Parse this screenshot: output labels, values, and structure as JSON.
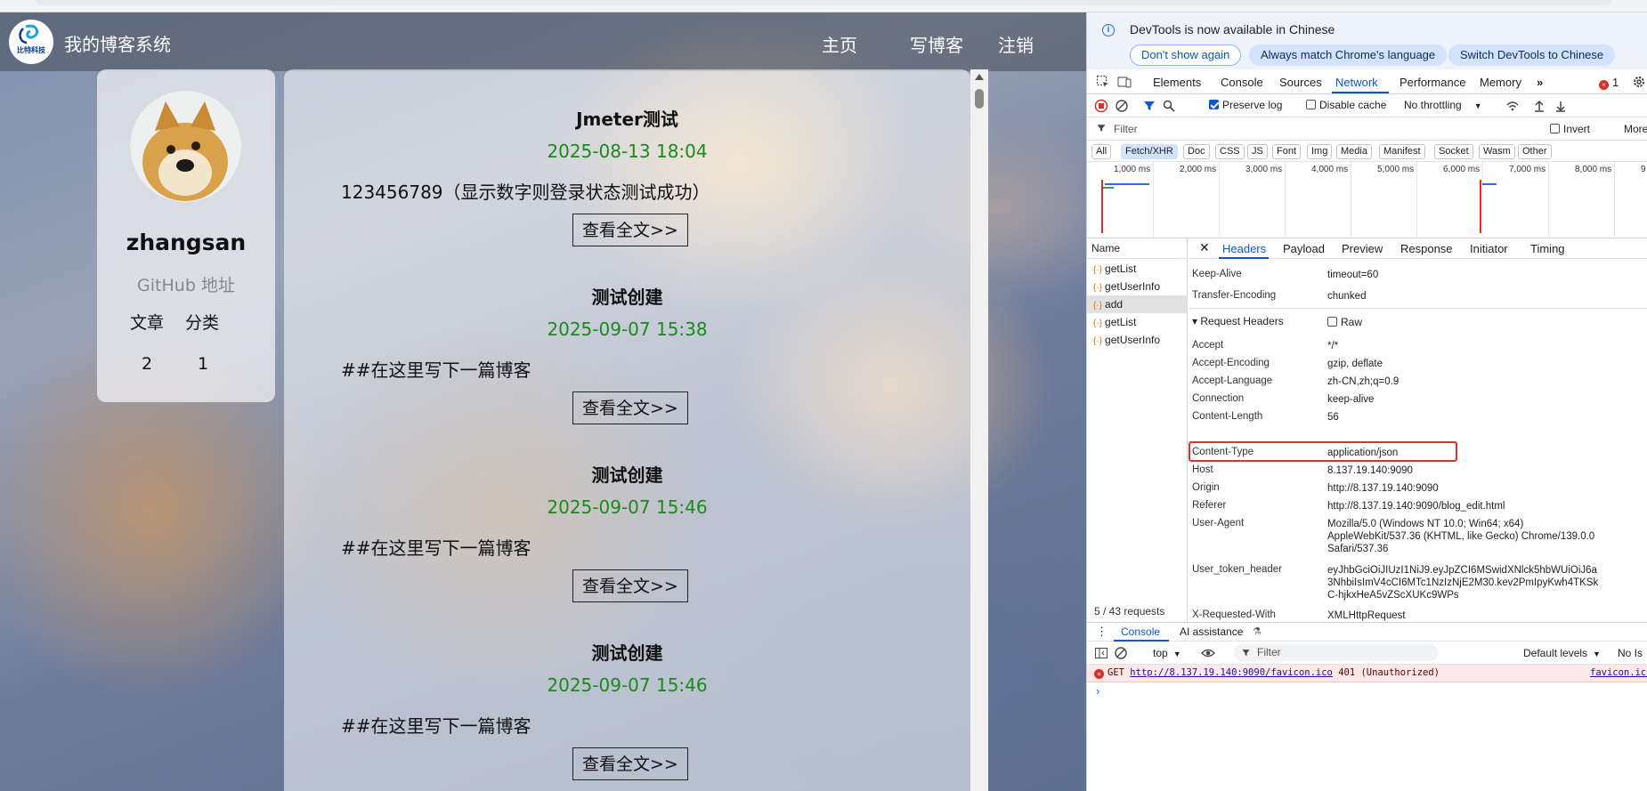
{
  "blog": {
    "site_title": "我的博客系统",
    "logo_text": "比特科技",
    "nav": {
      "home": "主页",
      "write": "写博客",
      "logout": "注销"
    },
    "profile": {
      "username": "zhangsan",
      "github": "GitHub 地址",
      "articles_label": "文章",
      "categories_label": "分类",
      "articles_count": "2",
      "categories_count": "1"
    },
    "articles": [
      {
        "title": "Jmeter测试",
        "date": "2025-08-13 18:04",
        "desc": "123456789（显示数字则登录状态测试成功）",
        "button": "查看全文>>"
      },
      {
        "title": "测试创建",
        "date": "2025-09-07 15:38",
        "desc": "##在这里写下一篇博客",
        "button": "查看全文>>"
      },
      {
        "title": "测试创建",
        "date": "2025-09-07 15:46",
        "desc": "##在这里写下一篇博客",
        "button": "查看全文>>"
      },
      {
        "title": "测试创建",
        "date": "2025-09-07 15:46",
        "desc": "##在这里写下一篇博客",
        "button": "查看全文>>"
      }
    ]
  },
  "devtools": {
    "info": {
      "text": "DevTools is now available in Chinese",
      "btn_dont_show": "Don't show again",
      "btn_match": "Always match Chrome's language",
      "btn_switch": "Switch DevTools to Chinese"
    },
    "tabs": [
      "Elements",
      "Console",
      "Sources",
      "Network",
      "Performance",
      "Memory"
    ],
    "active_tab": "Network",
    "more_tabs": "»",
    "error_count": "1",
    "controls": {
      "preserve_log": "Preserve log",
      "disable_cache": "Disable cache",
      "throttling": "No throttling"
    },
    "filter": {
      "placeholder": "Filter",
      "invert": "Invert",
      "more": "More"
    },
    "type_filters": [
      "All",
      "Fetch/XHR",
      "Doc",
      "CSS",
      "JS",
      "Font",
      "Img",
      "Media",
      "Manifest",
      "Socket",
      "Wasm",
      "Other"
    ],
    "timeline_labels": [
      "1,000 ms",
      "2,000 ms",
      "3,000 ms",
      "4,000 ms",
      "5,000 ms",
      "6,000 ms",
      "7,000 ms",
      "8,000 ms",
      "9"
    ],
    "requests_header": "Name",
    "requests": [
      "getList",
      "getUserInfo",
      "add",
      "getList",
      "getUserInfo"
    ],
    "selected_request": "add",
    "request_count": "5 / 43 requests",
    "detail_tabs": [
      "Headers",
      "Payload",
      "Preview",
      "Response",
      "Initiator",
      "Timing"
    ],
    "response_headers": [
      {
        "name": "Keep-Alive",
        "value": "timeout=60"
      },
      {
        "name": "Transfer-Encoding",
        "value": "chunked"
      }
    ],
    "request_headers_title": "▾ Request Headers",
    "raw_label": "Raw",
    "request_headers": [
      {
        "name": "Accept",
        "value": "*/*"
      },
      {
        "name": "Accept-Encoding",
        "value": "gzip, deflate"
      },
      {
        "name": "Accept-Language",
        "value": "zh-CN,zh;q=0.9"
      },
      {
        "name": "Connection",
        "value": "keep-alive"
      },
      {
        "name": "Content-Length",
        "value": "56"
      },
      {
        "name": "Content-Type",
        "value": "application/json"
      },
      {
        "name": "Host",
        "value": "8.137.19.140:9090"
      },
      {
        "name": "Origin",
        "value": "http://8.137.19.140:9090"
      },
      {
        "name": "Referer",
        "value": "http://8.137.19.140:9090/blog_edit.html"
      },
      {
        "name": "User-Agent",
        "value": "Mozilla/5.0 (Windows NT 10.0; Win64; x64)\nAppleWebKit/537.36 (KHTML, like Gecko) Chrome/139.0.0\nSafari/537.36"
      },
      {
        "name": "User_token_header",
        "value": "eyJhbGciOiJIUzI1NiJ9.eyJpZCI6MSwidXNlck5hbWUiOiJ6a\n3NhbiIsImV4cCI6MTc1NzIzNjE2M30.kev2PmIpyKwh4TKSk\nC-hjkxHeA5vZScXUKc9WPs"
      },
      {
        "name": "X-Requested-With",
        "value": "XMLHttpRequest"
      }
    ],
    "console": {
      "tab": "Console",
      "ai_tab": "AI assistance",
      "context": "top",
      "filter_placeholder": "Filter",
      "levels": "Default levels",
      "no_issues": "No Is",
      "error_method": "GET",
      "error_url": "http://8.137.19.140:9090/favicon.ico",
      "error_status": "401 (Unauthorized)",
      "error_source": "favicon.ico",
      "prompt": "›"
    }
  }
}
